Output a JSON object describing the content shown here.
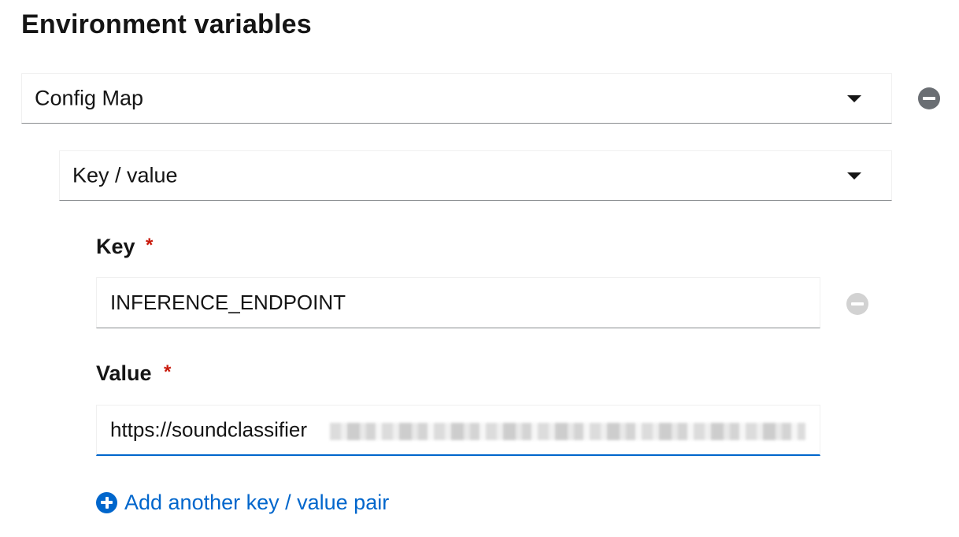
{
  "section": {
    "title": "Environment variables"
  },
  "env_var": {
    "type_select": {
      "selected": "Config Map",
      "icon": "caret-down-icon"
    },
    "source_select": {
      "selected": "Key / value",
      "icon": "caret-down-icon"
    },
    "remove_icon": "minus-circle-icon",
    "remove_icon_color": "#6a6e73"
  },
  "pair": {
    "key": {
      "label": "Key",
      "required_marker": "*",
      "value": "INFERENCE_ENDPOINT"
    },
    "value": {
      "label": "Value",
      "required_marker": "*",
      "value": "https://soundclassifier"
    },
    "remove_icon": "minus-circle-icon",
    "remove_icon_color": "#d2d2d2"
  },
  "add_pair": {
    "label": "Add another key / value pair",
    "icon": "plus-circle-icon"
  },
  "colors": {
    "link": "#0066cc",
    "required": "#c9190b",
    "focus_border": "#0066cc"
  }
}
